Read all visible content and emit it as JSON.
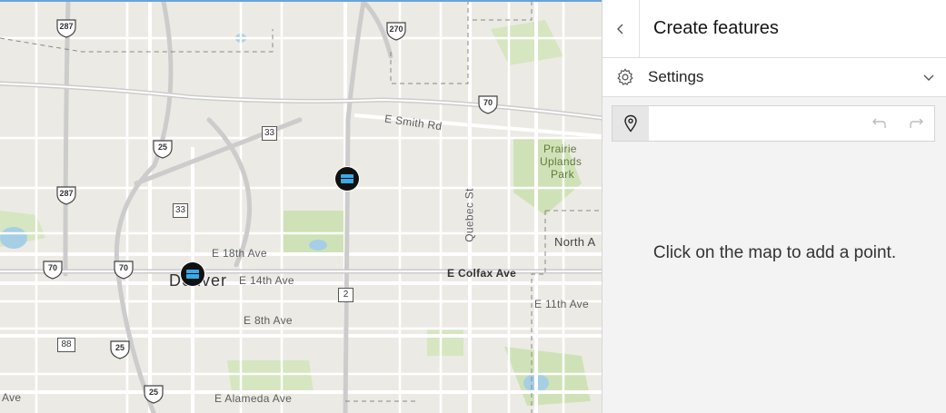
{
  "map": {
    "labels": {
      "smith_rd": "E Smith Rd",
      "prairie": "Prairie",
      "uplands": "Uplands",
      "park": "Park",
      "quebec_st": "Quebec St",
      "north_a": "North A",
      "e_18th_ave": "E 18th Ave",
      "denver": "Denver",
      "e_14th_ave": "E 14th Ave",
      "e_colfax_ave": "E Colfax Ave",
      "e_11th_ave": "E 11th Ave",
      "e_8th_ave": "E 8th Ave",
      "ave_left": "Ave",
      "e_alameda_ave": "E Alameda Ave"
    },
    "shields": {
      "i270": "270",
      "us287_top": "287",
      "i70_top": "70",
      "co33_top": "33",
      "i25_top": "25",
      "us287_mid": "287",
      "co33_mid": "33",
      "i70_left": "70",
      "i70_mid": "70",
      "co2": "2",
      "co88": "88",
      "i25_mid": "25",
      "i25_bottom": "25"
    }
  },
  "panel": {
    "title": "Create features",
    "settings_label": "Settings",
    "hint": "Click on the map to add a point."
  },
  "icons": {
    "back": "chevron-left-icon",
    "gear": "gear-icon",
    "expand": "chevron-down-icon",
    "point": "map-pin-icon",
    "undo": "undo-icon",
    "redo": "redo-icon",
    "marker": "transit-marker-icon"
  },
  "colors": {
    "park_green": "#cfe2b7",
    "water": "#a6cfe6",
    "road": "#ffffff",
    "highway": "#d2d2d2",
    "marker_fill": "#39a9e8"
  }
}
